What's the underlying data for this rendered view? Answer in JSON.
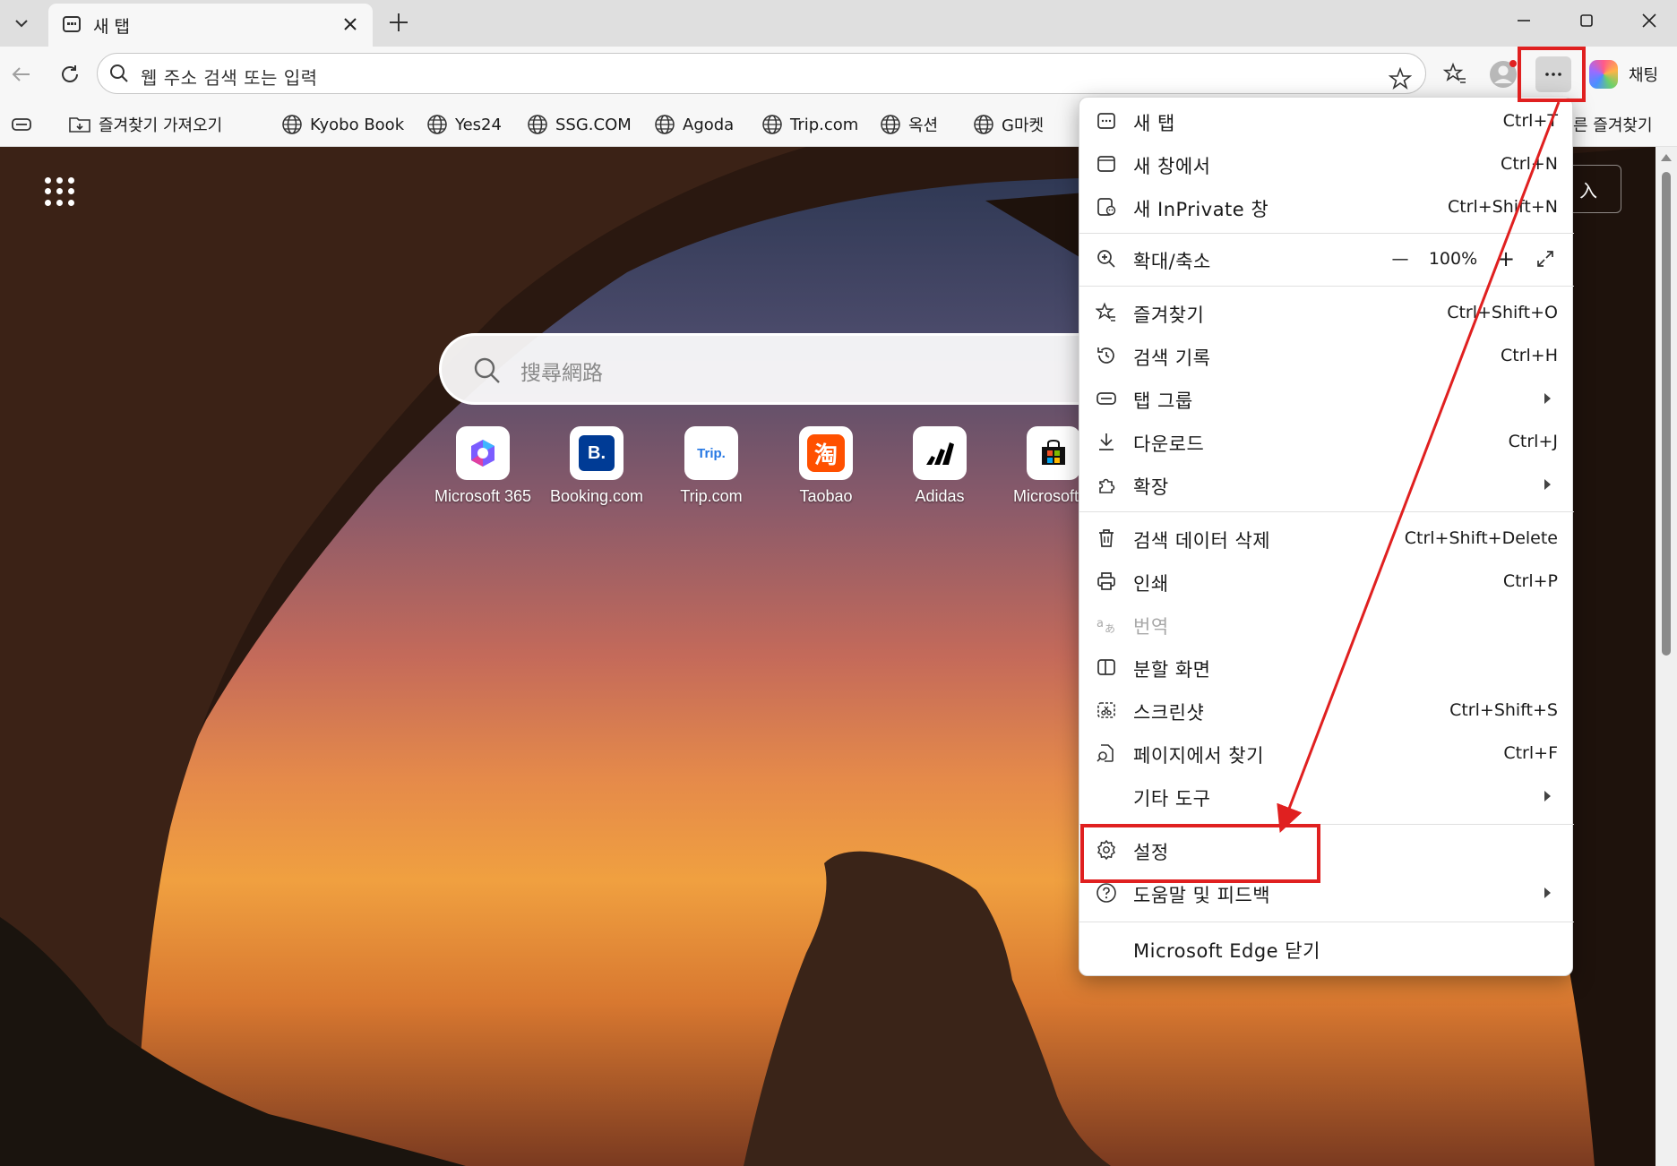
{
  "tab": {
    "title": "새 탭",
    "close_label": "✕"
  },
  "toolbar": {
    "address_placeholder": "웹 주소 검색 또는 입력",
    "copilot_label": "채팅"
  },
  "favorites": [
    {
      "label": "즐겨찾기 가져오기"
    },
    {
      "label": "Kyobo Book"
    },
    {
      "label": "Yes24"
    },
    {
      "label": "SSG.COM"
    },
    {
      "label": "Agoda"
    },
    {
      "label": "Trip.com"
    },
    {
      "label": "옥션"
    },
    {
      "label": "G마켓"
    },
    {
      "label": "른 즐겨찾기"
    }
  ],
  "newtab": {
    "search_placeholder": "搜尋網路",
    "signin_fragment": "入",
    "quick_links": [
      {
        "label": "Microsoft 365",
        "icon": "m365-icon"
      },
      {
        "label": "Booking.com",
        "icon_text": "B."
      },
      {
        "label": "Trip.com",
        "icon_text": "Trip."
      },
      {
        "label": "Taobao",
        "icon_text": "淘"
      },
      {
        "label": "Adidas",
        "icon": "adidas-icon"
      },
      {
        "label": "Microsoft S",
        "icon": "store-icon"
      }
    ]
  },
  "menu": {
    "items": [
      {
        "label": "새 탭",
        "shortcut": "Ctrl+T"
      },
      {
        "label": "새 창에서",
        "shortcut": "Ctrl+N"
      },
      {
        "label": "새 InPrivate 창",
        "shortcut": "Ctrl+Shift+N"
      },
      {
        "label": "확대/축소",
        "zoom_value": "100%",
        "zoom_minus": "—",
        "zoom_plus": "+"
      },
      {
        "label": "즐겨찾기",
        "shortcut": "Ctrl+Shift+O"
      },
      {
        "label": "검색 기록",
        "shortcut": "Ctrl+H"
      },
      {
        "label": "탭 그룹"
      },
      {
        "label": "다운로드",
        "shortcut": "Ctrl+J"
      },
      {
        "label": "확장"
      },
      {
        "label": "검색 데이터 삭제",
        "shortcut": "Ctrl+Shift+Delete"
      },
      {
        "label": "인쇄",
        "shortcut": "Ctrl+P"
      },
      {
        "label": "번역",
        "disabled": true
      },
      {
        "label": "분할 화면"
      },
      {
        "label": "스크린샷",
        "shortcut": "Ctrl+Shift+S"
      },
      {
        "label": "페이지에서 찾기",
        "shortcut": "Ctrl+F"
      },
      {
        "label": "기타 도구"
      },
      {
        "label": "설정"
      },
      {
        "label": "도움말 및 피드백"
      },
      {
        "label": "Microsoft Edge 닫기"
      }
    ]
  },
  "colors": {
    "highlight": "#e02020",
    "menu_bg": "#ffffff",
    "toolbar_bg": "#f7f7f7"
  }
}
